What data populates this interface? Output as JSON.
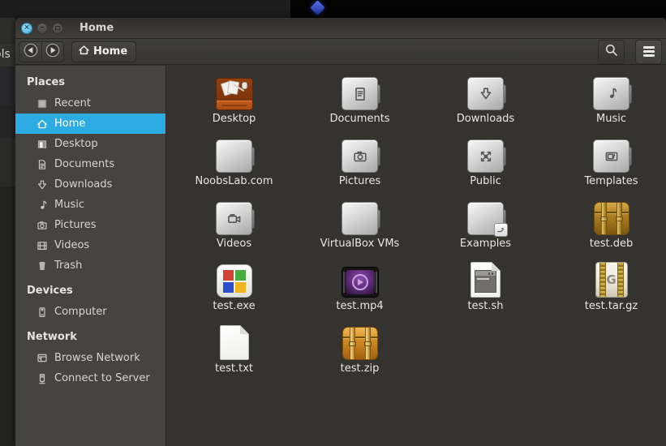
{
  "desktop": {
    "wallpaper_text_fragment": "ols"
  },
  "window": {
    "title": "Home",
    "titlebar_buttons": {
      "close": "close",
      "minimize": "minimize",
      "maximize": "maximize"
    },
    "toolbar": {
      "back_icon": "back-arrow",
      "forward_icon": "forward-arrow",
      "breadcrumb": {
        "icon": "home",
        "label": "Home"
      },
      "search_icon": "search",
      "menu_icon": "hamburger-menu"
    },
    "sidebar": {
      "sections": [
        {
          "header": "Places",
          "items": [
            {
              "label": "Recent",
              "icon": "recent"
            },
            {
              "label": "Home",
              "icon": "home",
              "selected": true
            },
            {
              "label": "Desktop",
              "icon": "desktop"
            },
            {
              "label": "Documents",
              "icon": "documents"
            },
            {
              "label": "Downloads",
              "icon": "downloads"
            },
            {
              "label": "Music",
              "icon": "music"
            },
            {
              "label": "Pictures",
              "icon": "pictures"
            },
            {
              "label": "Videos",
              "icon": "videos"
            },
            {
              "label": "Trash",
              "icon": "trash"
            }
          ]
        },
        {
          "header": "Devices",
          "items": [
            {
              "label": "Computer",
              "icon": "computer"
            }
          ]
        },
        {
          "header": "Network",
          "items": [
            {
              "label": "Browse Network",
              "icon": "browse-network"
            },
            {
              "label": "Connect to Server",
              "icon": "connect-server"
            }
          ]
        }
      ]
    },
    "files": [
      {
        "name": "Desktop",
        "icon": "desktop-special"
      },
      {
        "name": "Documents",
        "icon": "folder-documents"
      },
      {
        "name": "Downloads",
        "icon": "folder-downloads"
      },
      {
        "name": "Music",
        "icon": "folder-music"
      },
      {
        "name": "NoobsLab.com",
        "icon": "folder-plain"
      },
      {
        "name": "Pictures",
        "icon": "folder-pictures"
      },
      {
        "name": "Public",
        "icon": "folder-public"
      },
      {
        "name": "Templates",
        "icon": "folder-templates"
      },
      {
        "name": "Videos",
        "icon": "folder-videos"
      },
      {
        "name": "VirtualBox VMs",
        "icon": "folder-plain"
      },
      {
        "name": "Examples",
        "icon": "folder-link"
      },
      {
        "name": "test.deb",
        "icon": "package-deb"
      },
      {
        "name": "test.exe",
        "icon": "file-exe"
      },
      {
        "name": "test.mp4",
        "icon": "file-video"
      },
      {
        "name": "test.sh",
        "icon": "file-script"
      },
      {
        "name": "test.tar.gz",
        "icon": "file-archive"
      },
      {
        "name": "test.txt",
        "icon": "file-text"
      },
      {
        "name": "test.zip",
        "icon": "package-zip"
      }
    ]
  },
  "colors": {
    "selection_blue": "#2dace3",
    "close_button_blue": "#6ac4e8",
    "folder_gray": "#c9c9c9",
    "package_gold": "#b78a24",
    "desktop_orange": "#93400f"
  }
}
